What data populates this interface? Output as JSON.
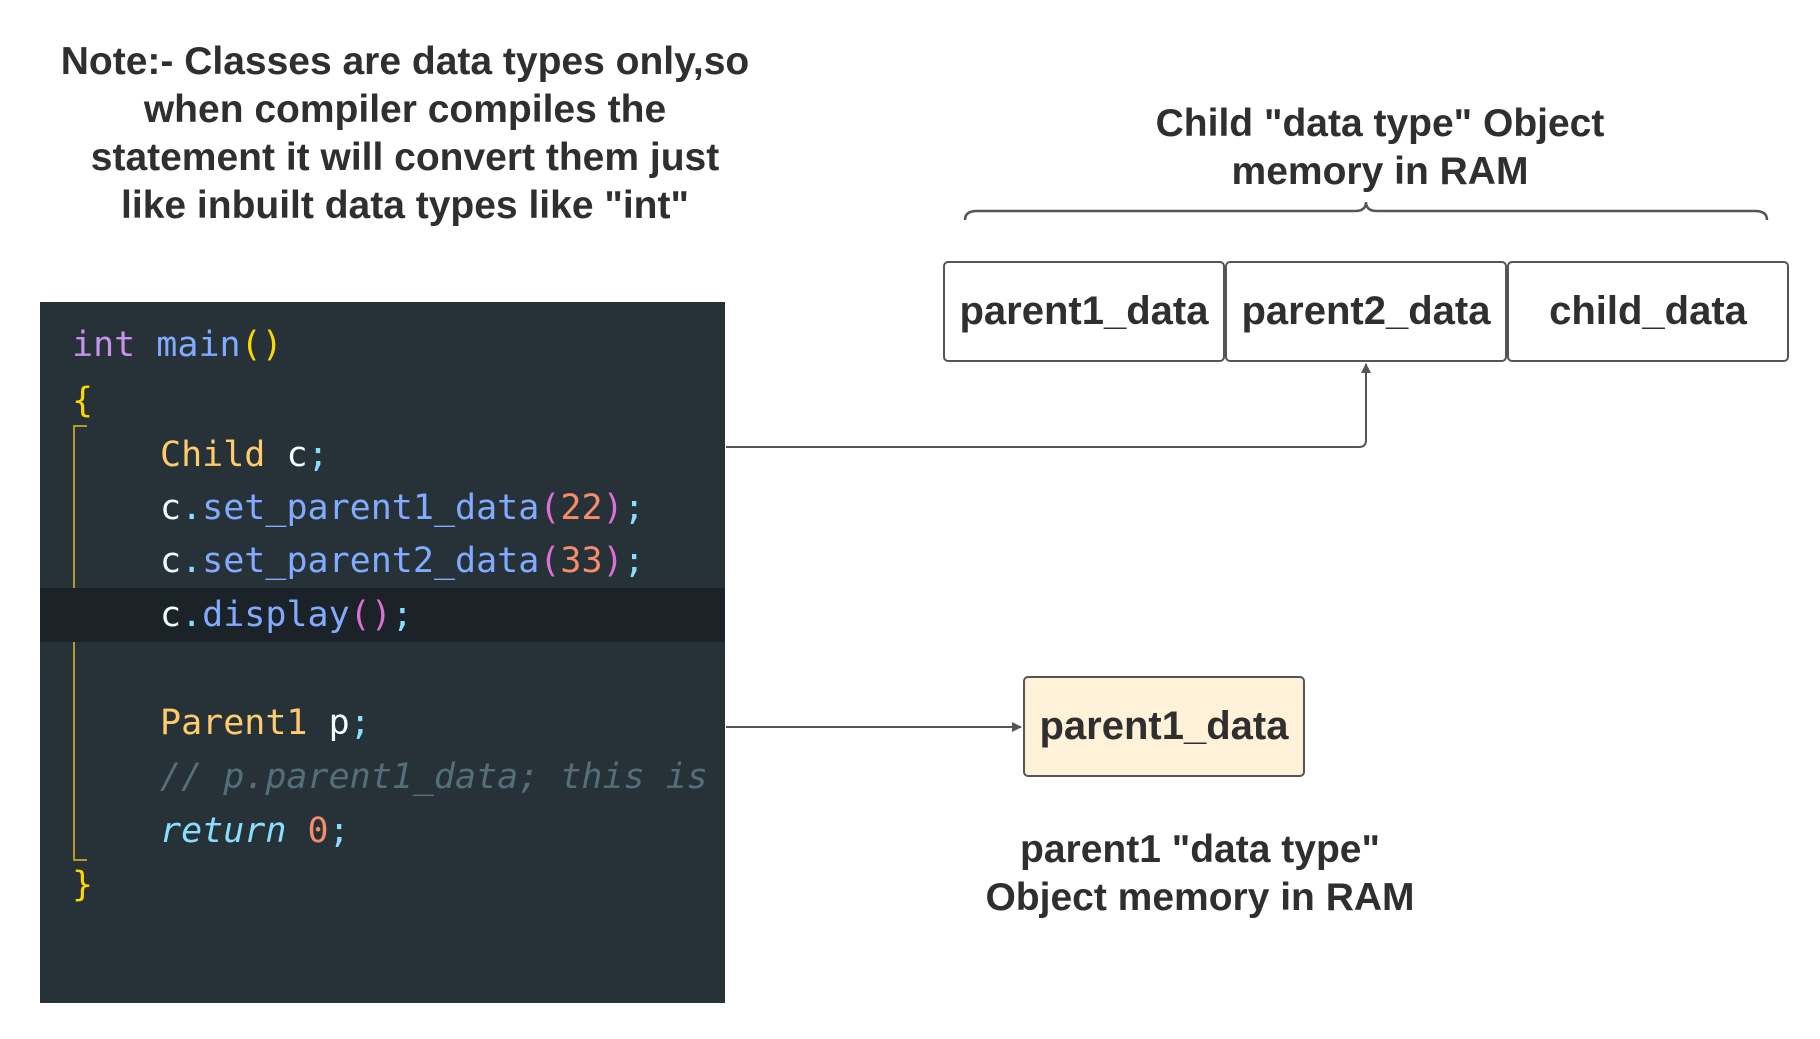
{
  "note": {
    "text": "Note:- Classes are data types only,so\nwhen compiler compiles the\nstatement it will convert them just\nlike inbuilt data types like \"int\""
  },
  "child_object": {
    "caption": "Child \"data type\" Object\nmemory in RAM",
    "cells": [
      "parent1_data",
      "parent2_data",
      "child_data"
    ]
  },
  "parent1_object": {
    "caption": "parent1 \"data type\"\nObject memory in RAM",
    "cells": [
      "parent1_data"
    ],
    "fill_color": "#fff2d8"
  },
  "code": {
    "line1": {
      "type": "int",
      "fn": "main",
      "parens": "()"
    },
    "line2": {
      "brace": "{"
    },
    "line3": {
      "cls": "Child",
      "var": "c",
      "end": ";"
    },
    "line4": {
      "obj": "c",
      "dot": ".",
      "fn": "set_parent1_data",
      "open": "(",
      "num": "22",
      "close": ")",
      "end": ";"
    },
    "line5": {
      "obj": "c",
      "dot": ".",
      "fn": "set_parent2_data",
      "open": "(",
      "num": "33",
      "close": ")",
      "end": ";"
    },
    "line6": {
      "obj": "c",
      "dot": ".",
      "fn": "display",
      "parens": "()",
      "end": ";"
    },
    "line8": {
      "cls": "Parent1",
      "var": "p",
      "end": ";"
    },
    "line9": {
      "comment": "// p.parent1_data; this is"
    },
    "line10": {
      "kw": "return",
      "num": "0",
      "end": ";"
    },
    "line11": {
      "brace": "}"
    },
    "colors": {
      "background": "#263238",
      "highlight_line": "#1c2328",
      "keyword_type": "#c792ea",
      "function": "#82aaff",
      "class_name": "#ffcb6b",
      "number": "#f78c6c",
      "comment": "#546e7a",
      "bracket": "#ffd700"
    }
  }
}
